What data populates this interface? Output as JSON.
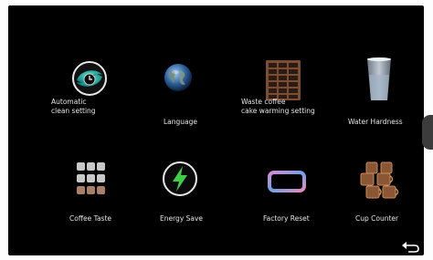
{
  "menu": {
    "items": [
      {
        "label": "Automatic\nclean setting",
        "icon": "clean-setting-icon"
      },
      {
        "label": "Language",
        "icon": "globe-icon"
      },
      {
        "label": "Waste coffee\ncake warming setting",
        "icon": "coffee-grounds-container-icon"
      },
      {
        "label": "Water Hardness",
        "icon": "water-glass-icon"
      },
      {
        "label": "Coffee Taste",
        "icon": "grid-dots-icon"
      },
      {
        "label": "Energy Save",
        "icon": "lightning-bolt-icon"
      },
      {
        "label": "Factory Reset",
        "icon": "reset-frame-icon"
      },
      {
        "label": "Cup Counter",
        "icon": "coffee-cups-icon"
      }
    ]
  },
  "navigation": {
    "back_icon": "back-arrow-icon"
  },
  "colors": {
    "background": "#000000",
    "text": "#e6e6e6",
    "bolt": "#3ecf4a"
  }
}
